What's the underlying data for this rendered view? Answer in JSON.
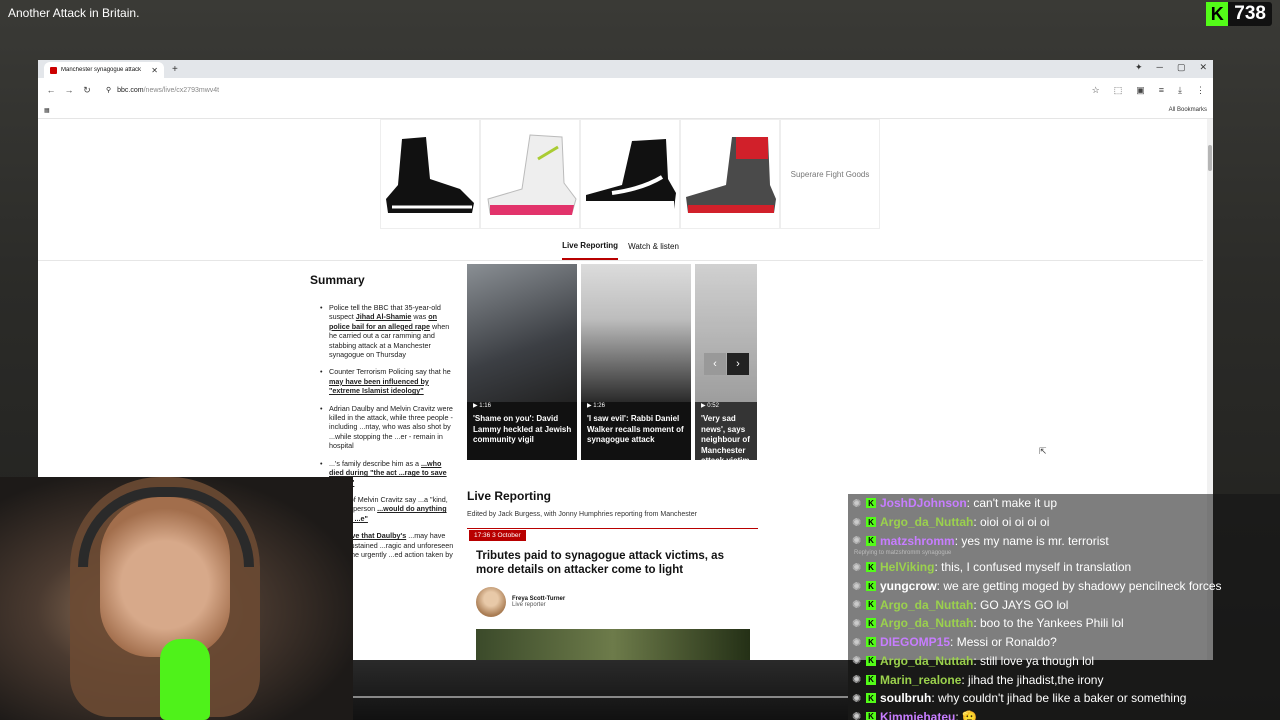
{
  "stream": {
    "title": "Another Attack in Britain.",
    "viewer_count": "738",
    "platform_letter": "K"
  },
  "browser": {
    "tab_title": "Manchester synagogue attack",
    "url_host": "bbc.com",
    "url_path": "/news/live/cx2793mwv4t",
    "bookmarks_label": "All Bookmarks"
  },
  "ad": {
    "brand_text": "Superare Fight Goods"
  },
  "nav": {
    "tab_live": "Live Reporting",
    "tab_watch": "Watch & listen"
  },
  "summary": {
    "title": "Summary",
    "items": [
      {
        "pre": "Police tell the BBC that 35-year-old suspect ",
        "bold": "Jihad Al-Shamie",
        "mid": " was ",
        "bold2": "on police bail for an alleged rape",
        "post": " when he carried out a car ramming and stabbing attack at a Manchester synagogue on Thursday"
      },
      {
        "pre": "Counter Terrorism Policing say that he ",
        "bold": "may have been influenced by \"extreme Islamist ideology\"",
        "mid": "",
        "bold2": "",
        "post": ""
      },
      {
        "pre": "Adrian Daulby and Melvin Cravitz were killed in the attack, while three people - including",
        "bold": "",
        "mid": "",
        "bold2": "",
        "post": " ...ntay, who was also shot by ...while stopping the ...er - remain in hospital"
      },
      {
        "pre": "...'s family describe him as a ",
        "bold": "...who died during \"the act ...rage to save others\"",
        "mid": "",
        "bold2": "",
        "post": ""
      },
      {
        "pre": "...mily of Melvin Cravitz say ...a \"kind, caring\" person ",
        "bold": "...would do anything to help ...e\"",
        "mid": "",
        "bold2": "",
        "post": ""
      },
      {
        "pre": "",
        "bold": "...believe that Daulby's",
        "mid": "",
        "bold2": "",
        "post": " ...may have been sustained ...ragic and unforeseen ...e of the urgently ...ed action taken by our"
      }
    ]
  },
  "videos": [
    {
      "duration": "1:16",
      "caption": "'Shame on you': David Lammy heckled at Jewish community vigil"
    },
    {
      "duration": "1:26",
      "caption": "'I saw evil': Rabbi Daniel Walker recalls moment of synagogue attack"
    },
    {
      "duration": "0:52",
      "caption": "'Very sad news', says neighbour of Manchester attack victim"
    }
  ],
  "live": {
    "title": "Live Reporting",
    "edited_by": "Edited by Jack Burgess, with Jonny Humphries reporting from Manchester",
    "post_time": "17:36 3 October",
    "post_headline": "Tributes paid to synagogue attack victims, as more details on attacker come to light",
    "author_name": "Freya Scott-Turner",
    "author_role": "Live reporter"
  },
  "chat": [
    {
      "user": "JoshDJohnson",
      "color": "#c77dff",
      "msg": ": can't make it up"
    },
    {
      "user": "Argo_da_Nuttah",
      "color": "#9bd14d",
      "msg": ": oioi oi oi oi oi"
    },
    {
      "user": "matzshromm",
      "color": "#c77dff",
      "msg": ": yes my name is mr. terrorist"
    },
    {
      "user": "HelViking",
      "color": "#9bd14d",
      "msg": ": this, I confused myself in translation",
      "reply": "Replying to matzshromm synagogue"
    },
    {
      "user": "yungcrow",
      "color": "#ffffff",
      "msg": ": we are getting moged by shadowy pencilneck forces"
    },
    {
      "user": "Argo_da_Nuttah",
      "color": "#9bd14d",
      "msg": ": GO JAYS GO lol"
    },
    {
      "user": "Argo_da_Nuttah",
      "color": "#9bd14d",
      "msg": ": boo to the Yankees Phili lol"
    },
    {
      "user": "DIEGOMP15",
      "color": "#c77dff",
      "msg": ": Messi or Ronaldo?"
    },
    {
      "user": "Argo_da_Nuttah",
      "color": "#9bd14d",
      "msg": ": still love ya though lol"
    },
    {
      "user": "Marin_realone",
      "color": "#9bd14d",
      "msg": ": jihad the jihadist,the irony"
    },
    {
      "user": "soulbruh",
      "color": "#ffffff",
      "msg": ": why couldn't jihad be like a baker or something"
    },
    {
      "user": "Kimmiehateu",
      "color": "#c77dff",
      "msg": ": 🫡"
    }
  ]
}
